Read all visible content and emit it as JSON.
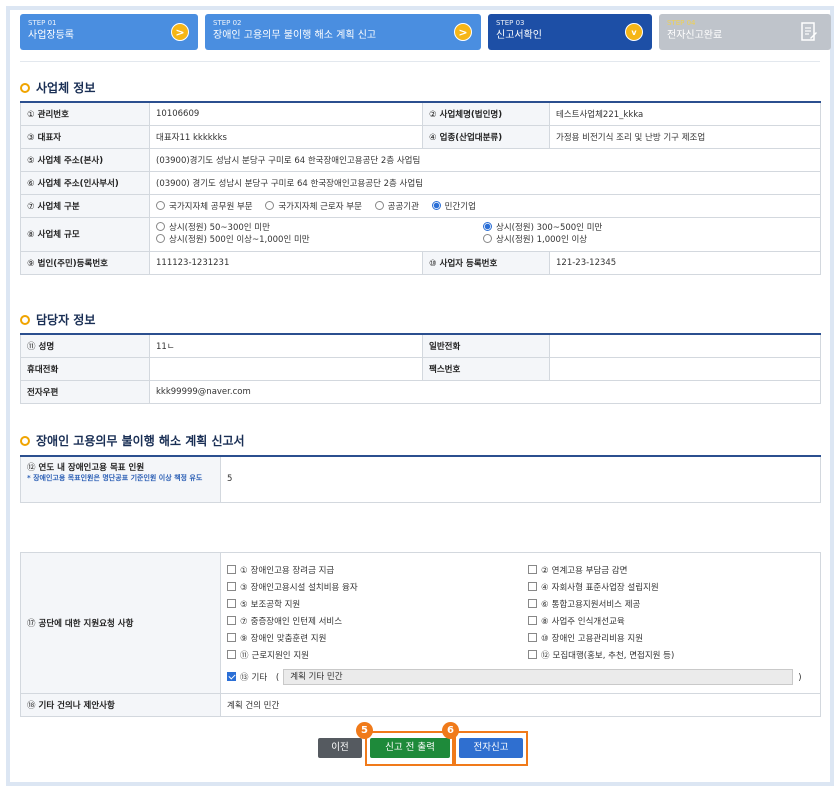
{
  "steps": [
    {
      "num": "STEP 01",
      "title": "사업장등록",
      "arrow": ">"
    },
    {
      "num": "STEP 02",
      "title": "장애인 고용의무 불이행 해소 계획 신고",
      "arrow": ">"
    },
    {
      "num": "STEP 03",
      "title": "신고서확인",
      "arrow": "v"
    },
    {
      "num": "STEP 04",
      "title": "전자신고완료"
    }
  ],
  "company": {
    "title": "사업체 정보",
    "rows": {
      "mgmt_no_label": "관리번호",
      "mgmt_no": "10106609",
      "name_label": "사업체명(법인명)",
      "name": "테스트사업체221_kkka",
      "ceo_label": "대표자",
      "ceo": "대표자11 kkkkkks",
      "industry_label": "업종(산업대분류)",
      "industry": "가정용 비전기식 조리 및 난방 기구 제조업",
      "addr_main_label": "사업체 주소(본사)",
      "addr_main": "(03900)경기도 성남시 분당구 구미로 64 한국장애인고용공단 2층 사업팀",
      "addr_hr_label": "사업체 주소(인사부서)",
      "addr_hr": "(03900) 경기도 성남시 분당구 구미로 64 한국장애인고용공단 2층 사업팀",
      "type_label": "사업체 구분",
      "type_options": [
        "국가지자체 공무원 부문",
        "국가지자체 근로자 부문",
        "공공기관",
        "민간기업"
      ],
      "scale_label": "사업체 규모",
      "scale_options": [
        "상시(정원) 50~300인 미만",
        "상시(정원) 500인 이상~1,000인 미만",
        "상시(정원) 300~500인 미만",
        "상시(정원) 1,000인 이상"
      ],
      "corp_reg_label": "법인(주민)등록번호",
      "corp_reg": "111123-1231231",
      "biz_reg_label": "사업자 등록번호",
      "biz_reg": "121-23-12345"
    }
  },
  "contact": {
    "title": "담당자 정보",
    "name_label": "성명",
    "name": "11ㄴ",
    "phone_label": "일반전화",
    "phone": "",
    "mobile_label": "휴대전화",
    "mobile": "",
    "fax_label": "팩스번호",
    "fax": "",
    "email_label": "전자우편",
    "email": "kkk99999@naver.com"
  },
  "plan": {
    "title": "장애인 고용의무 불이행 해소 계획 신고서",
    "target_label": "연도 내 장애인고용 목표 인원",
    "target_note": "* 장애인고용 목표인원은 명단공표 기준인원 이상 책정 유도",
    "target_value": "5",
    "support_label": "공단에 대한 지원요청 사항",
    "support_items": [
      "장애인고용 장려금 지급",
      "연계고용 부담금 감면",
      "장애인고용시설 설치비용 융자",
      "자회사형 표준사업장 설립지원",
      "보조공학 지원",
      "통합고용지원서비스 제공",
      "중증장애인 인턴제 서비스",
      "사업주 인식개선교육",
      "장애인 맞춤훈련 지원",
      "장애인 고용관리비용 지원",
      "근로지원인 지원",
      "모집대행(홍보, 추천, 면접지원 등)"
    ],
    "etc_label": "기타",
    "etc_value": "계획 기타 민간",
    "other_label": "기타 건의나 제안사항",
    "other_value": "계획 건의 민간"
  },
  "buttons": {
    "prev": "이전",
    "print": "신고 전 출력",
    "submit": "전자신고"
  },
  "badges": {
    "print": "5",
    "submit": "6"
  },
  "colors": {
    "accent": "#2b4f8f",
    "highlight": "#f07a1a",
    "step_active": "#1d4fa6"
  }
}
